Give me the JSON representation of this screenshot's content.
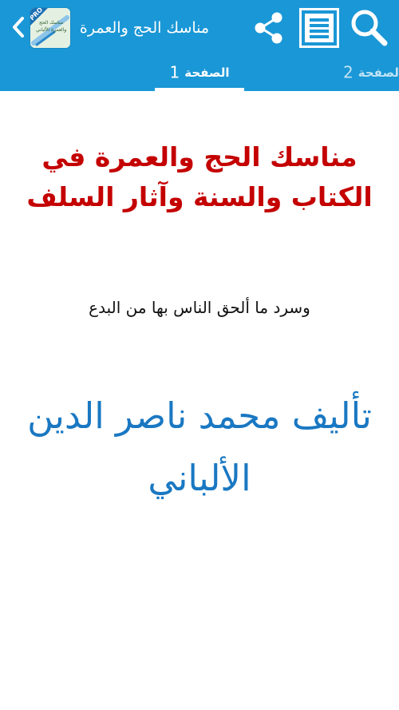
{
  "action_bar": {
    "title": "مناسك الحج والعمرة",
    "app_icon_badge": "PRO",
    "app_icon_caption": "مناسك الحج والعمرة الألباني",
    "colors": {
      "bar": "#1a97d6",
      "text": "#ffffff"
    },
    "icons": {
      "back": "chevron-left-icon",
      "share": "share-icon",
      "toc": "list-icon",
      "search": "search-icon"
    }
  },
  "tabs": [
    {
      "number": "1",
      "label": "الصفحة",
      "selected": true
    },
    {
      "number": "2",
      "label": "الصفحة",
      "selected": false
    }
  ],
  "page": {
    "title": "مناسك الحج والعمرة في الكتاب والسنة وآثار السلف",
    "subtitle": "وسرد ما ألحق الناس بها من البدع",
    "author": "تأليف محمد ناصر الدين الألباني",
    "colors": {
      "title": "#c40000",
      "subtitle": "#111111",
      "author": "#1a78c2"
    }
  }
}
